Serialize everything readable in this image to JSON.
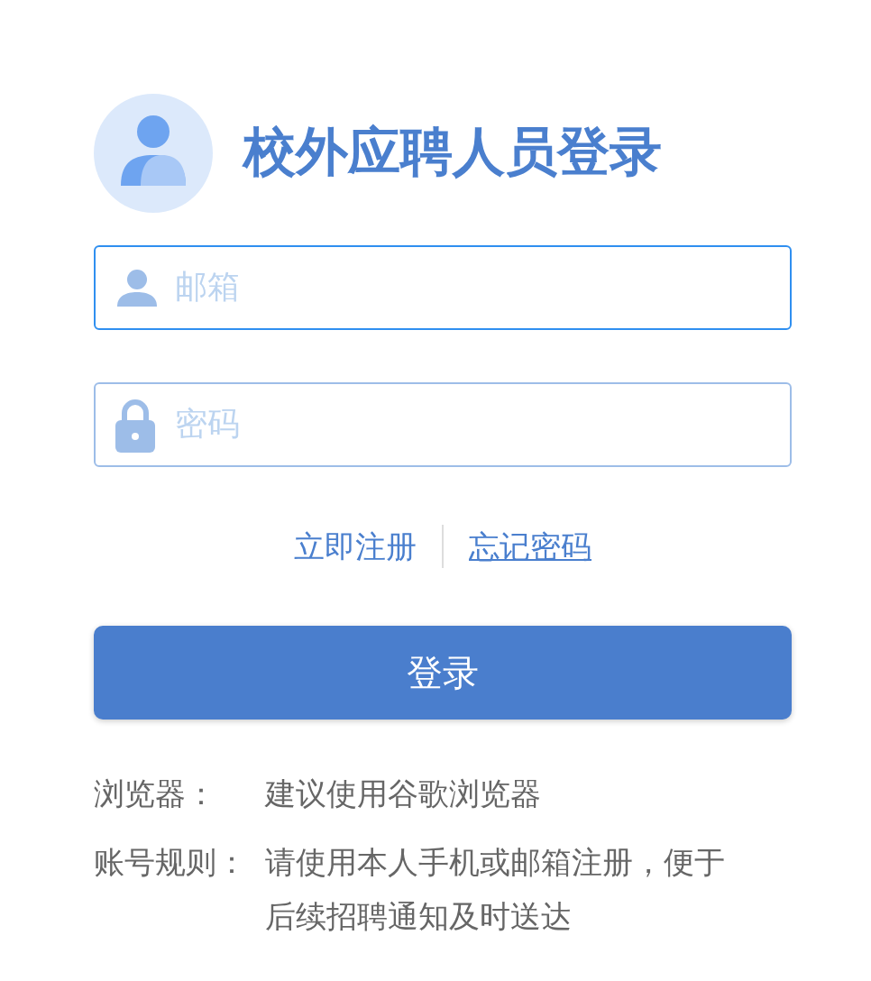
{
  "title": "校外应聘人员登录",
  "fields": [
    {
      "kind": "user",
      "placeholder": "邮箱",
      "focused": true
    },
    {
      "kind": "lock",
      "placeholder": "密码",
      "focused": false
    }
  ],
  "links": [
    "立即注册",
    "忘记密码"
  ],
  "login_button": "登录",
  "notes": [
    {
      "label": "浏览器：",
      "text": "建议使用谷歌浏览器"
    },
    {
      "label": "账号规则：",
      "text": "请使用本人手机或邮箱注册，便于后续招聘通知及时送达"
    }
  ]
}
